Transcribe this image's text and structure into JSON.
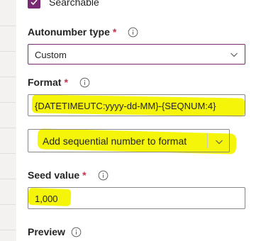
{
  "searchable": {
    "label": "Searchable",
    "checked": true
  },
  "autonumber_type": {
    "label": "Autonumber type",
    "required_mark": "*",
    "value": "Custom"
  },
  "format": {
    "label": "Format",
    "required_mark": "*",
    "value": "{DATETIMEUTC:yyyy-dd-MM}-{SEQNUM:4}"
  },
  "add_sequential": {
    "label": "Add sequential number to format"
  },
  "seed_value": {
    "label": "Seed value",
    "required_mark": "*",
    "value": "1,000"
  },
  "preview": {
    "label": "Preview"
  },
  "colors": {
    "accent": "#7a2a72",
    "required": "#c4314b",
    "highlight": "#f5f50a"
  }
}
